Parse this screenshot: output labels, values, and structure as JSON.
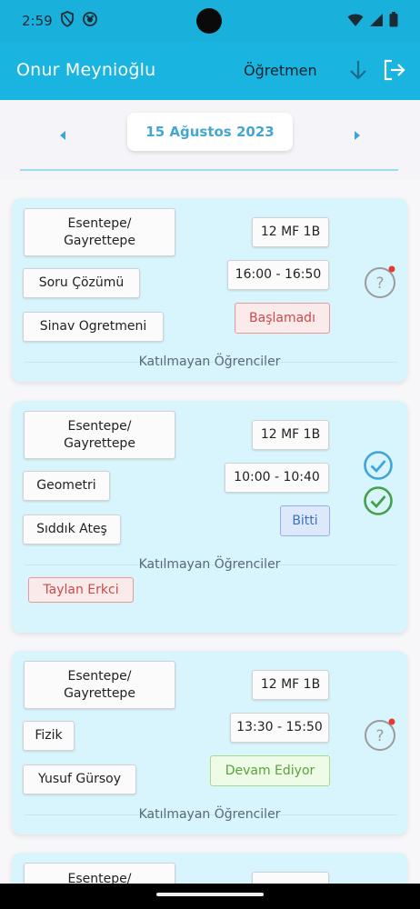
{
  "status_bar": {
    "time": "2:59"
  },
  "app_bar": {
    "user_name": "Onur Meynioğlu",
    "role": "Öğretmen"
  },
  "date_nav": {
    "date": "15 Ağustos 2023"
  },
  "absent_label": "Katılmayan Öğrenciler",
  "lessons": [
    {
      "location": "Esentepe/\nGayrettepe",
      "subject": "Soru Çözümü",
      "teacher": "Sinav Ogretmeni",
      "class": "12 MF 1B",
      "time": "16:00 - 16:50",
      "status": "Başlamadı",
      "absent_students": []
    },
    {
      "location": "Esentepe/\nGayrettepe",
      "subject": "Geometri",
      "teacher": "Sıddık Ateş",
      "class": "12 MF 1B",
      "time": "10:00 - 10:40",
      "status": "Bitti",
      "absent_students": [
        "Taylan Erkci"
      ]
    },
    {
      "location": "Esentepe/\nGayrettepe",
      "subject": "Fizik",
      "teacher": "Yusuf Gürsoy",
      "class": "12 MF 1B",
      "time": "13:30 - 15:50",
      "status": "Devam Ediyor",
      "absent_students": []
    },
    {
      "location": "Esentepe/"
    }
  ],
  "colors": {
    "primary": "#1ab4e0",
    "card_bg": "#d8f4fd",
    "status_not_started": "#c94a4a",
    "status_done": "#3a6fc4",
    "status_ongoing": "#58a33b"
  }
}
